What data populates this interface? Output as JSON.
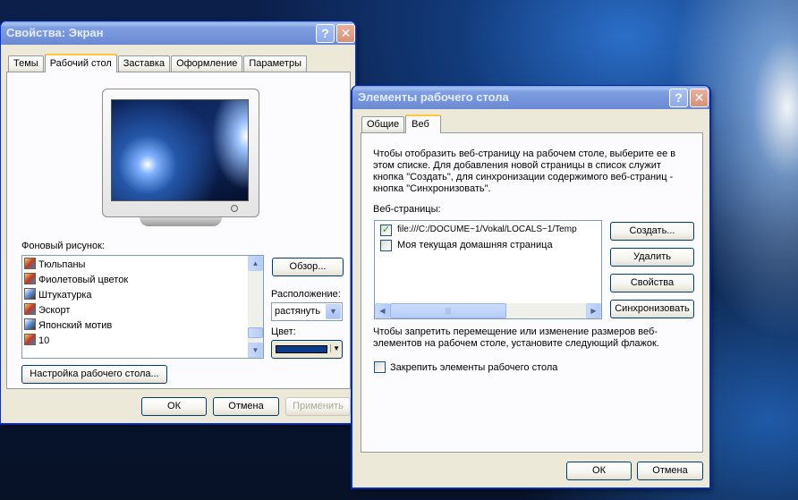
{
  "display_props": {
    "title": "Свойства: Экран",
    "tabs": [
      "Темы",
      "Рабочий стол",
      "Заставка",
      "Оформление",
      "Параметры"
    ],
    "background_label": "Фоновый рисунок:",
    "backgrounds": [
      "Тюльпаны",
      "Фиолетовый цветок",
      "Штукатурка",
      "Эскорт",
      "Японский мотив",
      "10"
    ],
    "browse_label": "Обзор...",
    "position_label": "Расположение:",
    "position_value": "растянуть",
    "color_label": "Цвет:",
    "color_value": "#0a3c8c",
    "customize_label": "Настройка рабочего стола...",
    "ok": "ОК",
    "cancel": "Отмена",
    "apply": "Применить"
  },
  "desktop_items": {
    "title": "Элементы рабочего стола",
    "tabs": [
      "Общие",
      "Веб"
    ],
    "description": "Чтобы отобразить веб-страницу на рабочем столе, выберите ее в этом списке. Для добавления новой страницы в список служит кнопка \"Создать\", для синхронизации содержимого веб-страниц - кнопка \"Синхронизовать\".",
    "webpages_label": "Веб-страницы:",
    "webpages": [
      "file:///C:/DOCUME~1/Vokal/LOCALS~1/Temp",
      "Моя текущая домашняя страница"
    ],
    "new_label": "Создать...",
    "delete_label": "Удалить",
    "properties_label": "Свойства",
    "sync_label": "Синхронизовать",
    "lock_text": "Чтобы запретить перемещение или изменение размеров веб-элементов на рабочем столе, установите следующий флажок.",
    "lock_label": "Закрепить элементы рабочего стола",
    "ok": "ОК",
    "cancel": "Отмена"
  },
  "colors": {
    "titlebar_active": "#0054e3",
    "titlebar_inactive": "#7a96df",
    "dialog_bg": "#ece9d8",
    "tab_highlight": "#ffc83c"
  }
}
